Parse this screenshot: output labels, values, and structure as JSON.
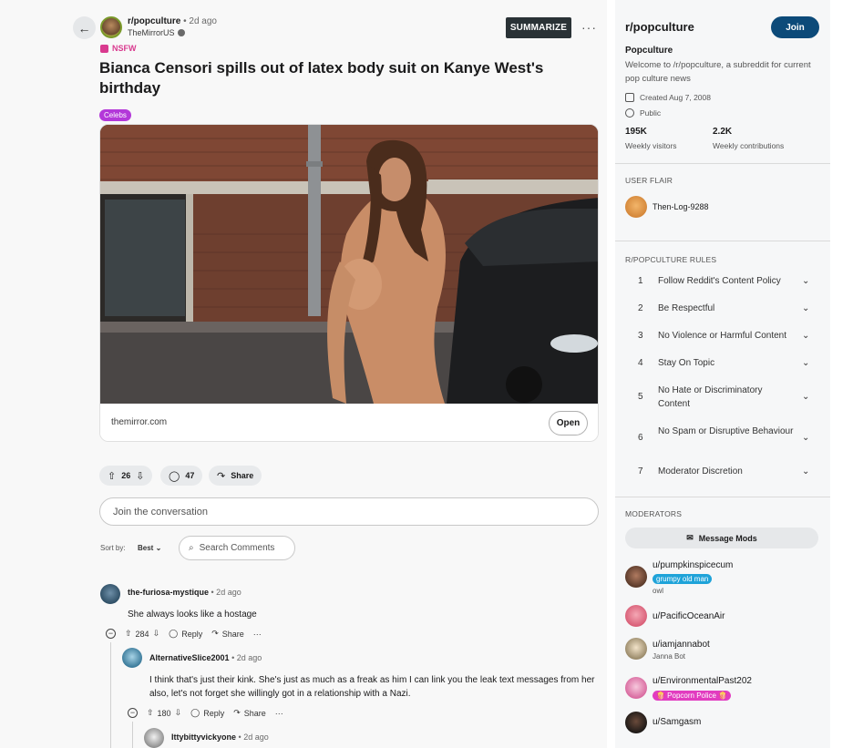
{
  "post": {
    "subreddit": "r/popculture",
    "time": "• 2d ago",
    "author": "TheMirrorUS",
    "summarize_label": "SUMMARIZE",
    "more_label": "···",
    "nsfw_label": "NSFW",
    "title": "Bianca Censori spills out of latex body suit on Kanye West's birthday",
    "flair": "Celebs",
    "domain": "themirror.com",
    "open_label": "Open",
    "upvotes": "26",
    "comments": "47",
    "share_label": "Share"
  },
  "conversation": {
    "placeholder": "Join the conversation",
    "sort_by_label": "Sort by:",
    "sort_value": "Best",
    "search_label": "Search Comments"
  },
  "comments": [
    {
      "user": "the-furiosa-mystique",
      "time": "• 2d ago",
      "text": "She always looks like a hostage",
      "score": "284",
      "reply_label": "Reply",
      "share_label": "Share",
      "more_label": "···"
    },
    {
      "user": "AlternativeSlice2001",
      "time": "• 2d ago",
      "text": "I think that's just their kink. She's just as much as a freak as him I can link you the leak text messages from her also, let's not forget she willingly got in a relationship with a Nazi.",
      "score": "180",
      "reply_label": "Reply",
      "share_label": "Share",
      "more_label": "···"
    },
    {
      "user": "Ittybittyvickyone",
      "time": "• 2d ago"
    }
  ],
  "sidebar": {
    "title": "r/popculture",
    "join_label": "Join",
    "name": "Popculture",
    "description": "Welcome to /r/popculture, a subreddit for current pop culture news",
    "created": "Created Aug 7, 2008",
    "visibility": "Public",
    "visitors_value": "195K",
    "visitors_label": "Weekly visitors",
    "contributions_value": "2.2K",
    "contributions_label": "Weekly contributions",
    "user_flair_heading": "USER FLAIR",
    "user_flair_name": "Then-Log-9288",
    "rules_heading": "R/POPCULTURE RULES",
    "rules": [
      {
        "num": "1",
        "text": "Follow Reddit's Content Policy"
      },
      {
        "num": "2",
        "text": "Be Respectful"
      },
      {
        "num": "3",
        "text": "No Violence or Harmful Content"
      },
      {
        "num": "4",
        "text": "Stay On Topic"
      },
      {
        "num": "5",
        "text": "No Hate or Discriminatory Content"
      },
      {
        "num": "6",
        "text": "No Spam or Disruptive Behaviour"
      },
      {
        "num": "7",
        "text": "Moderator Discretion"
      }
    ],
    "moderators_heading": "MODERATORS",
    "message_mods_label": "Message Mods",
    "moderators": [
      {
        "name": "u/pumpkinspicecum",
        "flair": "grumpy old man",
        "sub": "owl"
      },
      {
        "name": "u/PacificOceanAir"
      },
      {
        "name": "u/iamjannabot",
        "sub": "Janna Bot"
      },
      {
        "name": "u/EnvironmentalPast202",
        "flair": "🍿 Popcorn Police 🍿"
      },
      {
        "name": "u/Samgasm"
      }
    ]
  },
  "colors": {
    "join_button": "#0c4a79",
    "nsfw": "#d93a8f",
    "flair": "#b338d9",
    "summarize_button": "#2a3236"
  }
}
